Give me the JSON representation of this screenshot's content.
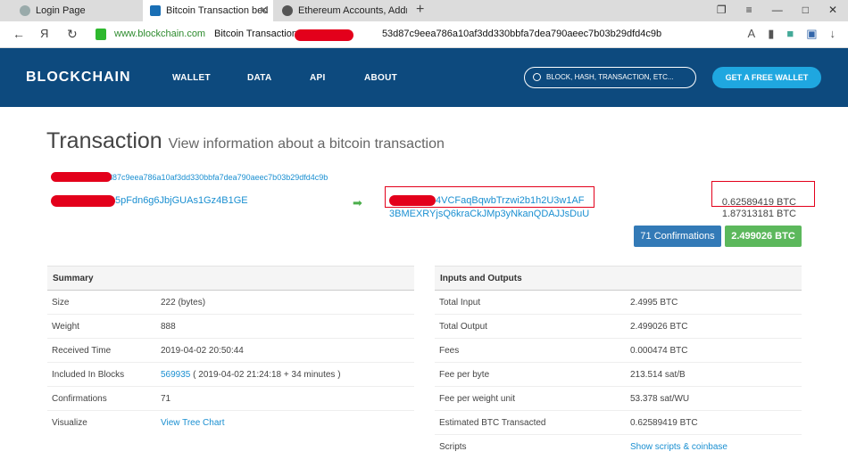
{
  "browser": {
    "tabs": [
      {
        "title": "Login Page"
      },
      {
        "title": "Bitcoin Transaction bed"
      },
      {
        "title": "Ethereum Accounts, Addre"
      }
    ],
    "url_domain": "www.blockchain.com",
    "url_path": "Bitcoin Transaction",
    "url_hash_tail": "53d87c9eea786a10af3dd330bbfa7dea790aeec7b03b29dfd4c9b",
    "back_glyph": "←",
    "yandex_glyph": "Я",
    "reload_glyph": "↻"
  },
  "site": {
    "logo": "BLOCKCHAIN",
    "menu": [
      "WALLET",
      "DATA",
      "API",
      "ABOUT"
    ],
    "search_placeholder": "BLOCK, HASH, TRANSACTION, ETC...",
    "get_wallet": "GET A FREE WALLET"
  },
  "page": {
    "title": "Transaction",
    "subtitle": "View information about a bitcoin transaction",
    "tx_hash_tail": "d87c9eea786a10af3dd330bbfa7dea790aeec7b03b29dfd4c9b",
    "input_address_tail": "5pFdn6g6JbjGUAs1Gz4B1GE",
    "output_address_1_tail": "4VCFaqBqwbTrzwi2b1h2U3w1AF",
    "output_address_2": "3BMEXRYjsQ6kraCkJMp3yNkanQDAJJsDuU",
    "output_amount_1": "0.62589419 BTC",
    "output_amount_2": "1.87313181 BTC",
    "confirmations": "71 Confirmations",
    "total_btc": "2.499026 BTC"
  },
  "summary": {
    "heading": "Summary",
    "rows": [
      {
        "k": "Size",
        "v": "222 (bytes)"
      },
      {
        "k": "Weight",
        "v": "888"
      },
      {
        "k": "Received Time",
        "v": "2019-04-02 20:50:44"
      },
      {
        "k": "Included In Blocks",
        "v_link": "569935",
        "v": "( 2019-04-02 21:24:18 + 34 minutes )"
      },
      {
        "k": "Confirmations",
        "v": "71"
      },
      {
        "k": "Visualize",
        "v_link": "View Tree Chart"
      }
    ]
  },
  "io": {
    "heading": "Inputs and Outputs",
    "rows": [
      {
        "k": "Total Input",
        "v": "2.4995 BTC"
      },
      {
        "k": "Total Output",
        "v": "2.499026 BTC"
      },
      {
        "k": "Fees",
        "v": "0.000474 BTC"
      },
      {
        "k": "Fee per byte",
        "v": "213.514 sat/B"
      },
      {
        "k": "Fee per weight unit",
        "v": "53.378 sat/WU"
      },
      {
        "k": "Estimated BTC Transacted",
        "v": "0.62589419 BTC"
      },
      {
        "k": "Scripts",
        "v_link": "Show scripts & coinbase"
      }
    ]
  }
}
